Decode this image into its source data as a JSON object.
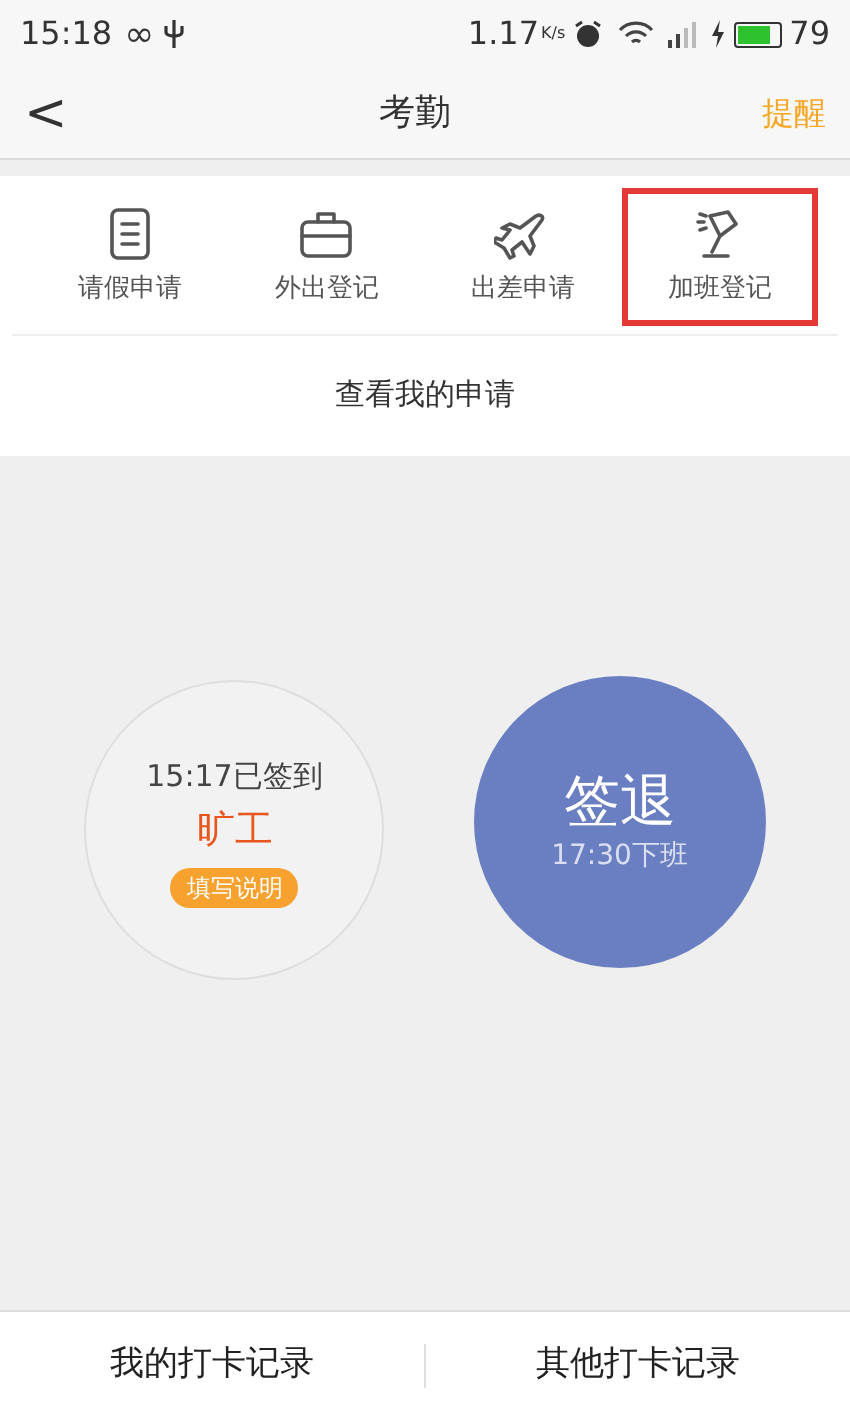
{
  "status_bar": {
    "time": "15:18",
    "loop_glyph": "∞",
    "speed": "1.17",
    "speed_unit": "K/s",
    "battery": "79"
  },
  "nav": {
    "back": "<",
    "title": "考勤",
    "action": "提醒"
  },
  "actions": [
    {
      "kind": "doc",
      "label": "请假申请",
      "highlighted": false
    },
    {
      "kind": "briefcase",
      "label": "外出登记",
      "highlighted": false
    },
    {
      "kind": "plane",
      "label": "出差申请",
      "highlighted": false
    },
    {
      "kind": "lamp",
      "label": "加班登记",
      "highlighted": true
    }
  ],
  "my_requests": "查看我的申请",
  "check_in": {
    "time_text": "15:17已签到",
    "status": "旷工",
    "explain_button": "填写说明"
  },
  "check_out": {
    "label": "签退",
    "sub": "17:30下班"
  },
  "bottom_tabs": [
    "我的打卡记录",
    "其他打卡记录"
  ]
}
